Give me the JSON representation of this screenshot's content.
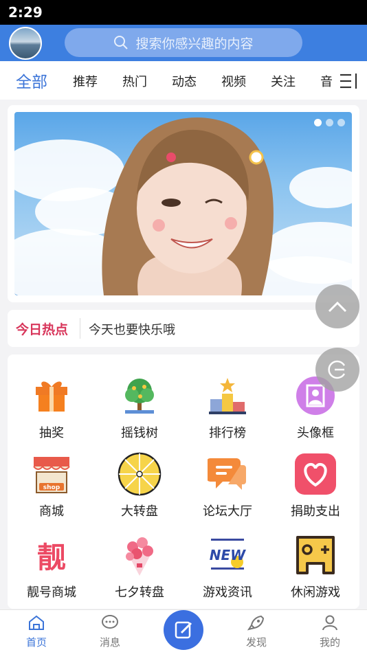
{
  "status_bar": {
    "time": "2:29"
  },
  "header": {
    "search_placeholder": "搜索你感兴趣的内容"
  },
  "tabs": [
    "全部",
    "推荐",
    "热门",
    "动态",
    "视频",
    "关注",
    "音"
  ],
  "banner": {
    "slide_count": 3,
    "active_slide": 1
  },
  "hot": {
    "label": "今日热点",
    "text": "今天也要快乐哦"
  },
  "grid": [
    {
      "label": "抽奖",
      "icon": "gift-icon"
    },
    {
      "label": "摇钱树",
      "icon": "money-tree-icon"
    },
    {
      "label": "排行榜",
      "icon": "podium-icon"
    },
    {
      "label": "头像框",
      "icon": "avatar-frame-icon"
    },
    {
      "label": "商城",
      "icon": "shop-icon"
    },
    {
      "label": "大转盘",
      "icon": "wheel-icon"
    },
    {
      "label": "论坛大厅",
      "icon": "forum-icon"
    },
    {
      "label": "捐助支出",
      "icon": "heart-icon"
    },
    {
      "label": "靓号商城",
      "icon": "liang-icon",
      "glyph": "靓"
    },
    {
      "label": "七夕转盘",
      "icon": "bouquet-icon"
    },
    {
      "label": "游戏资讯",
      "icon": "news-icon",
      "glyph": "NEW"
    },
    {
      "label": "休闲游戏",
      "icon": "gamepad-icon"
    }
  ],
  "bottom_nav": [
    {
      "label": "首页",
      "icon": "home-icon"
    },
    {
      "label": "消息",
      "icon": "message-icon"
    },
    {
      "label": "发现",
      "icon": "rocket-icon"
    },
    {
      "label": "我的",
      "icon": "user-icon"
    }
  ],
  "colors": {
    "primary": "#3d7fe0",
    "hot": "#d8365b"
  }
}
